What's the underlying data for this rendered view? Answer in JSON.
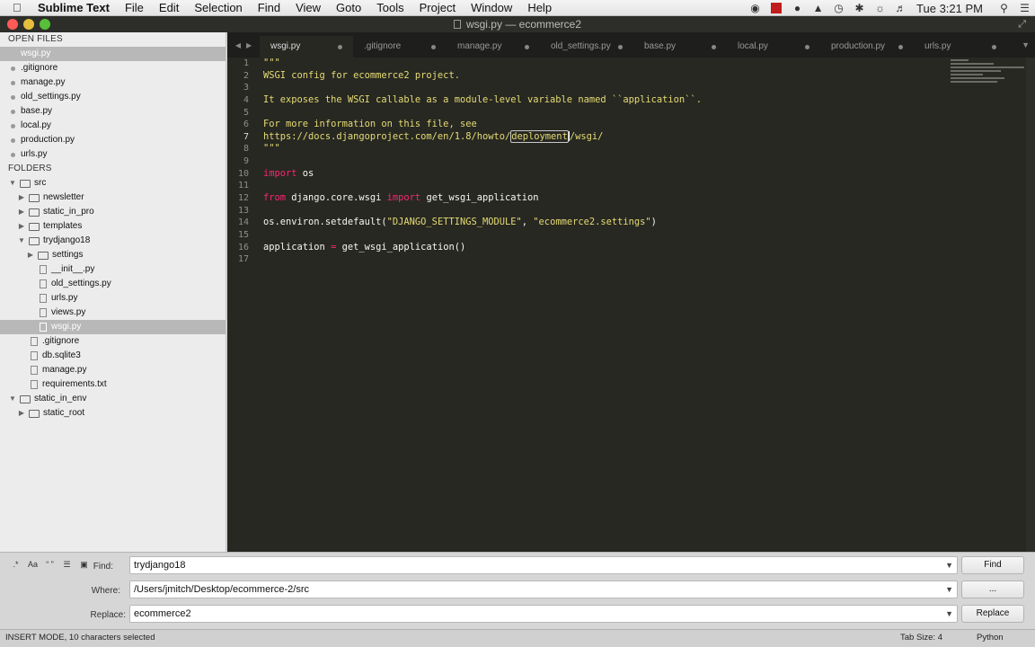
{
  "menubar": {
    "app": "Sublime Text",
    "items": [
      "File",
      "Edit",
      "Selection",
      "Find",
      "View",
      "Goto",
      "Tools",
      "Project",
      "Window",
      "Help"
    ],
    "clock": "Tue 3:21 PM"
  },
  "window": {
    "title": "wsgi.py — ecommerce2"
  },
  "sidebar": {
    "open_files_header": "OPEN FILES",
    "open_files": [
      ".gitignore",
      "manage.py",
      "old_settings.py",
      "base.py",
      "local.py",
      "production.py",
      "urls.py"
    ],
    "active_file": "wsgi.py",
    "folders_header": "FOLDERS",
    "tree": {
      "src": "src",
      "newsletter": "newsletter",
      "static_in_pro": "static_in_pro",
      "templates": "templates",
      "trydjango18": "trydjango18",
      "settings": "settings",
      "init": "__init__.py",
      "old_settings": "old_settings.py",
      "urls": "urls.py",
      "views": "views.py",
      "wsgi": "wsgi.py",
      "gitignore": ".gitignore",
      "db": "db.sqlite3",
      "manage": "manage.py",
      "requirements": "requirements.txt",
      "static_in_env": "static_in_env",
      "static_root": "static_root"
    }
  },
  "tabs": [
    "wsgi.py",
    ".gitignore",
    "manage.py",
    "old_settings.py",
    "base.py",
    "local.py",
    "production.py",
    "urls.py"
  ],
  "code": {
    "l1": "\"\"\"",
    "l2": "WSGI config for ecommerce2 project.",
    "l4": "It exposes the WSGI callable as a module-level variable named ``application``.",
    "l6": "For more information on this file, see",
    "l7a": "https://docs.djangoproject.com/en/1.8/howto/",
    "l7sel": "deployment",
    "l7b": "/wsgi/",
    "l8": "\"\"\"",
    "l10kw": "import",
    "l10": " os",
    "l12kw1": "from",
    "l12mid": " django.core.wsgi ",
    "l12kw2": "import",
    "l12end": " get_wsgi_application",
    "l14a": "os.environ.setdefault(",
    "l14s1": "\"DJANGO_SETTINGS_MODULE\"",
    "l14c": ", ",
    "l14s2": "\"ecommerce2.settings\"",
    "l14e": ")",
    "l16a": "application ",
    "l16op": "=",
    "l16b": " get_wsgi_application()"
  },
  "find": {
    "find_label": "Find:",
    "find_value": "trydjango18",
    "where_label": "Where:",
    "where_value": "/Users/jmitch/Desktop/ecommerce-2/src",
    "replace_label": "Replace:",
    "replace_value": "ecommerce2",
    "find_button": "Find",
    "where_button": "...",
    "replace_button": "Replace",
    "toggle_case": "Aa",
    "toggle_regex": ".*",
    "toggle_quotes": "“ ”"
  },
  "status": {
    "left": "INSERT MODE, 10 characters selected",
    "tab_size": "Tab Size: 4",
    "syntax": "Python"
  }
}
